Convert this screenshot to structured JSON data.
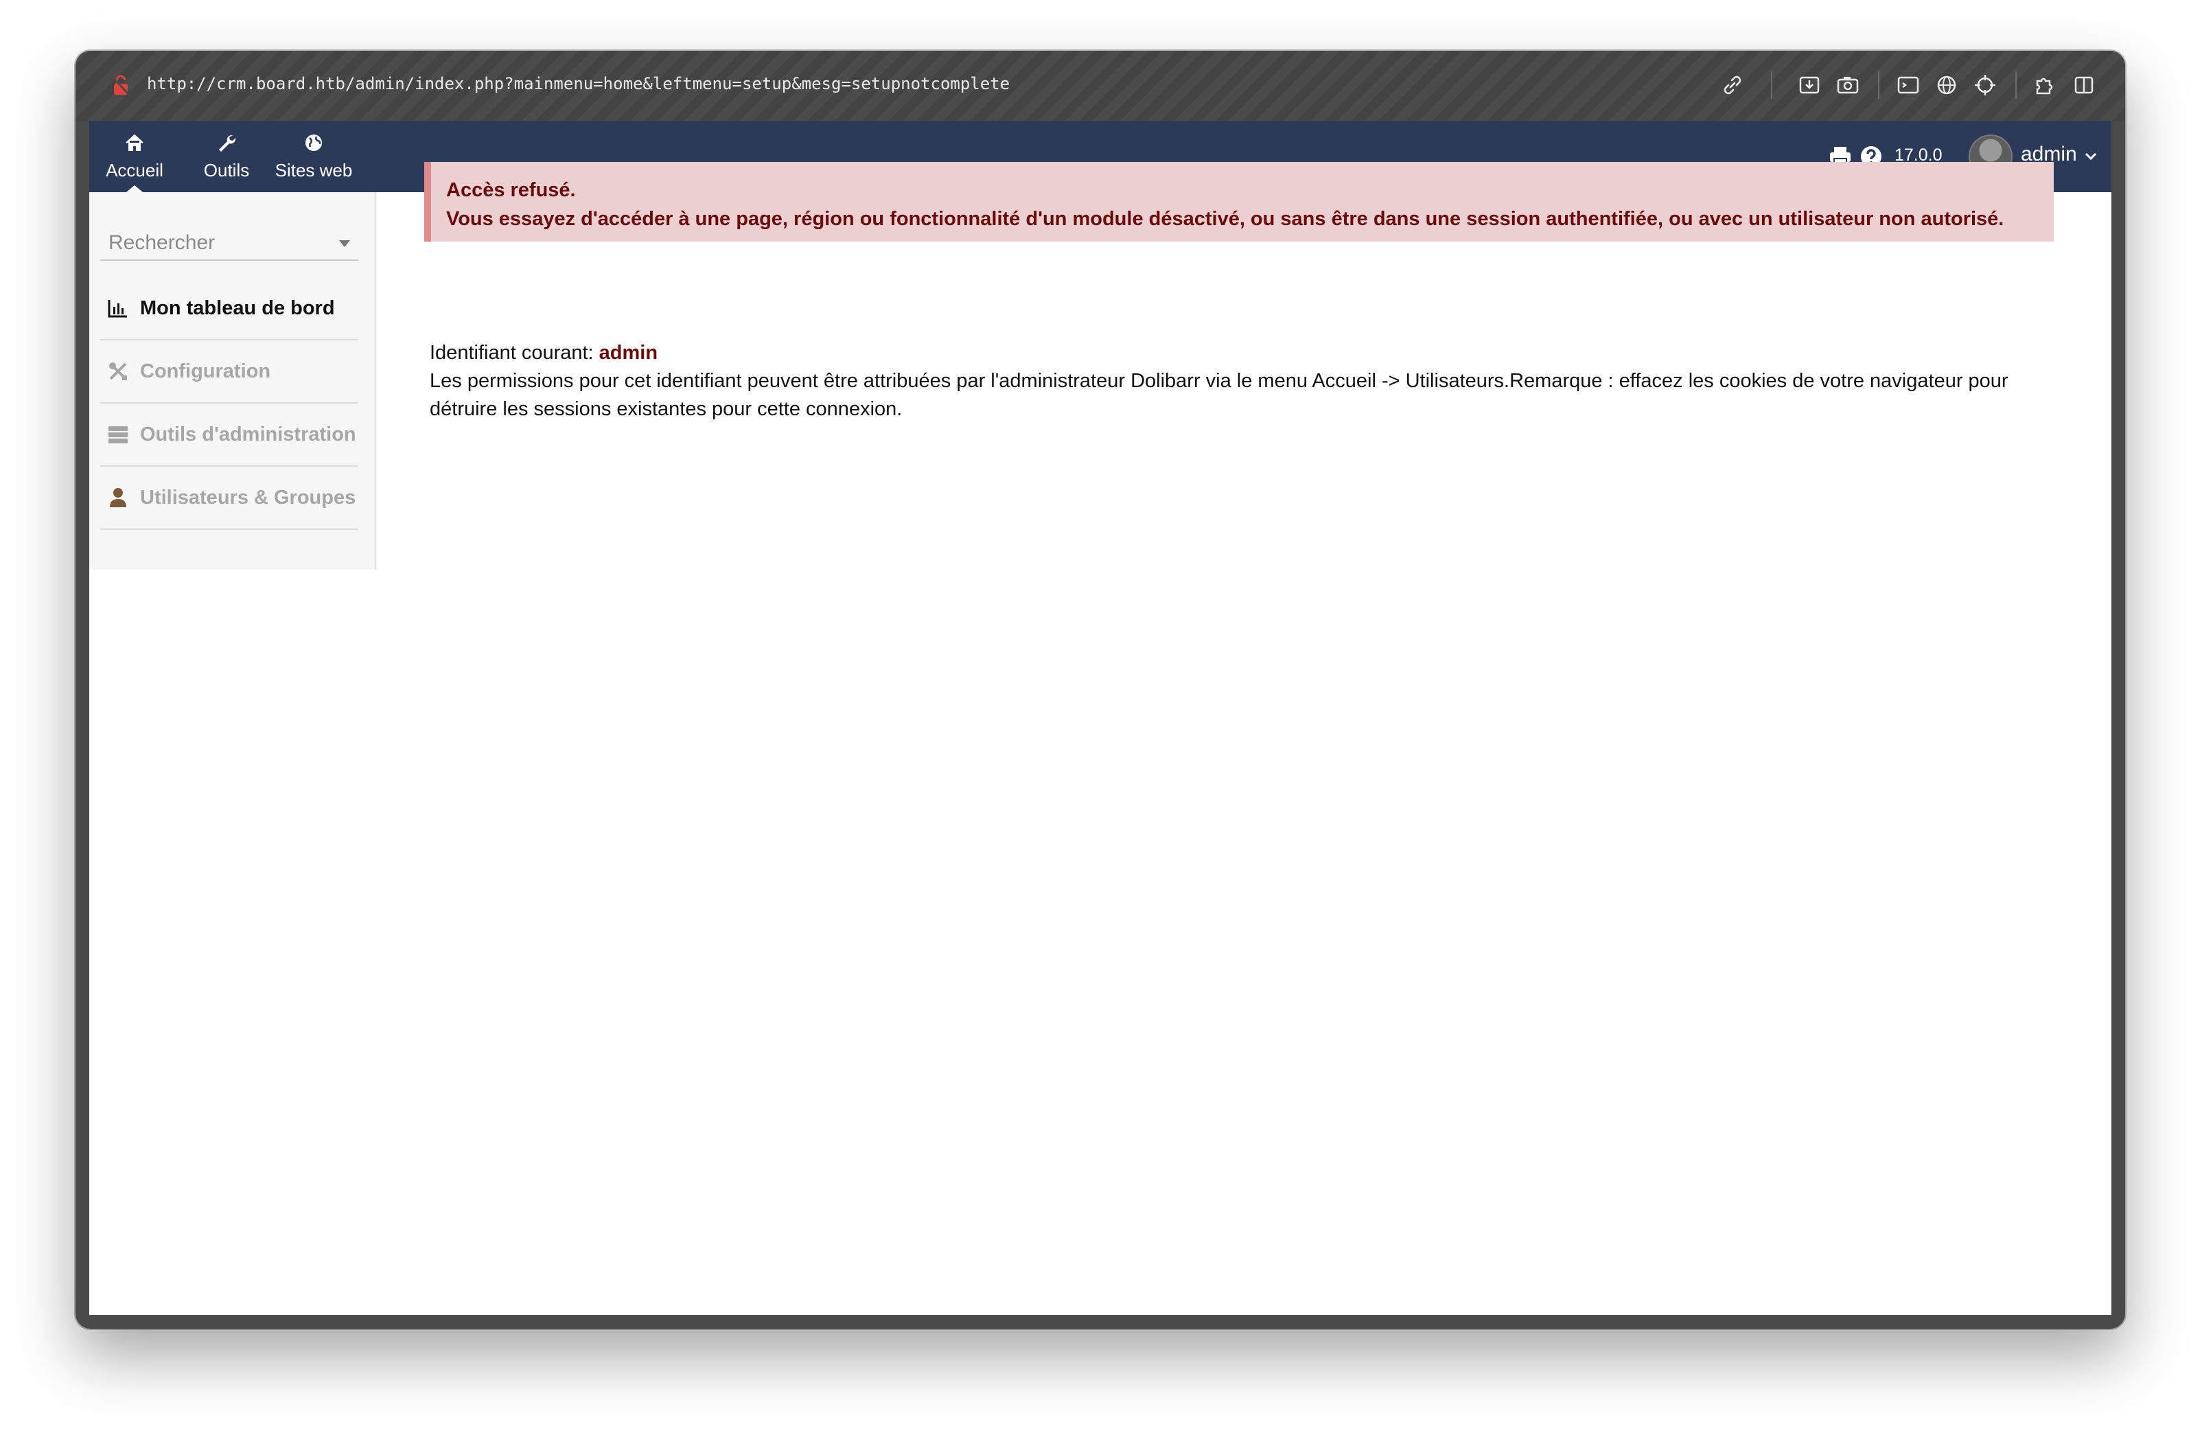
{
  "browser": {
    "url": "http://crm.board.htb/admin/index.php?mainmenu=home&leftmenu=setup&mesg=setupnotcomplete",
    "toolbar_icons": [
      "link-icon",
      "download-icon",
      "camera-icon",
      "terminal-icon",
      "globe-icon",
      "crosshair-icon",
      "extensions-icon",
      "sidebar-icon"
    ]
  },
  "topnav": {
    "items": [
      {
        "label": "Accueil",
        "icon": "home-icon"
      },
      {
        "label": "Outils",
        "icon": "wrench-icon"
      },
      {
        "label": "Sites web",
        "icon": "globe-icon"
      }
    ],
    "version": "17.0.0",
    "user": "admin"
  },
  "sidebar": {
    "search_placeholder": "Rechercher",
    "items": [
      {
        "label": "Mon tableau de bord",
        "icon": "chart-icon"
      },
      {
        "label": "Configuration",
        "icon": "tools-icon"
      },
      {
        "label": "Outils d'administration",
        "icon": "server-icon"
      },
      {
        "label": "Utilisateurs & Groupes",
        "icon": "user-icon"
      }
    ]
  },
  "alert": {
    "title": "Accès refusé.",
    "message": "Vous essayez d'accéder à une page, région ou fonctionnalité d'un module désactivé, ou sans être dans une session authentifiée, ou avec un utilisateur non autorisé."
  },
  "info": {
    "login_label": "Identifiant courant:",
    "login_value": "admin",
    "permissions_text": "Les permissions pour cet identifiant peuvent être attribuées par l'administrateur Dolibarr via le menu Accueil -> Utilisateurs.Remarque : effacez les cookies de votre navigateur pour détruire les sessions existantes pour cette connexion."
  },
  "colors": {
    "navbar": "#2c3a5a",
    "alert_bg": "#ecd0d1",
    "alert_border": "#e08a8c",
    "alert_text": "#6b0a0a"
  }
}
